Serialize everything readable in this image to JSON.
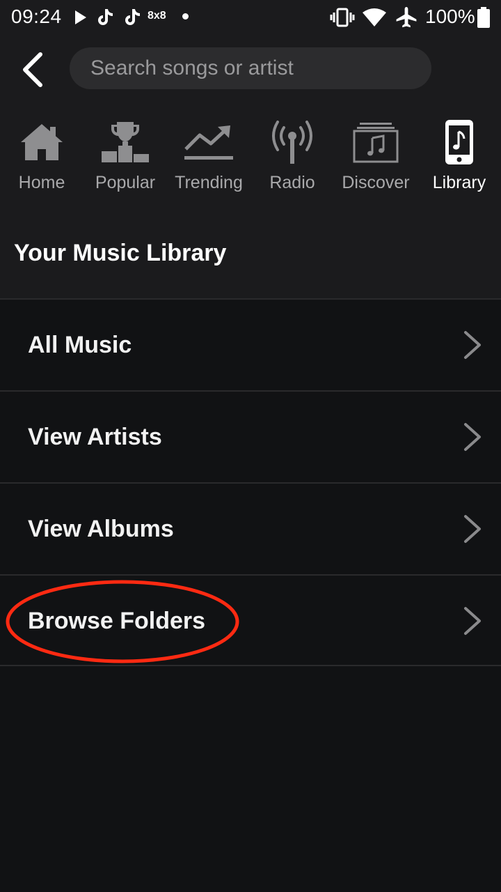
{
  "status_bar": {
    "time": "09:24",
    "badge": "8x8",
    "battery": "100%"
  },
  "search": {
    "placeholder": "Search songs or artist",
    "value": ""
  },
  "nav": {
    "tabs": [
      {
        "label": "Home",
        "icon": "home-icon",
        "active": false
      },
      {
        "label": "Popular",
        "icon": "trophy-podium-icon",
        "active": false
      },
      {
        "label": "Trending",
        "icon": "trending-icon",
        "active": false
      },
      {
        "label": "Radio",
        "icon": "radio-antenna-icon",
        "active": false
      },
      {
        "label": "Discover",
        "icon": "music-stack-icon",
        "active": false
      },
      {
        "label": "Library",
        "icon": "phone-music-icon",
        "active": true
      }
    ]
  },
  "library": {
    "title": "Your Music Library",
    "items": [
      {
        "label": "All Music"
      },
      {
        "label": "View Artists"
      },
      {
        "label": "View Albums"
      },
      {
        "label": "Browse Folders"
      }
    ]
  },
  "colors": {
    "background": "#111214",
    "header_background": "#1b1b1d",
    "search_background": "#2c2c2e",
    "tab_inactive": "#a9a9ab",
    "annotation": "#ff2a12"
  }
}
